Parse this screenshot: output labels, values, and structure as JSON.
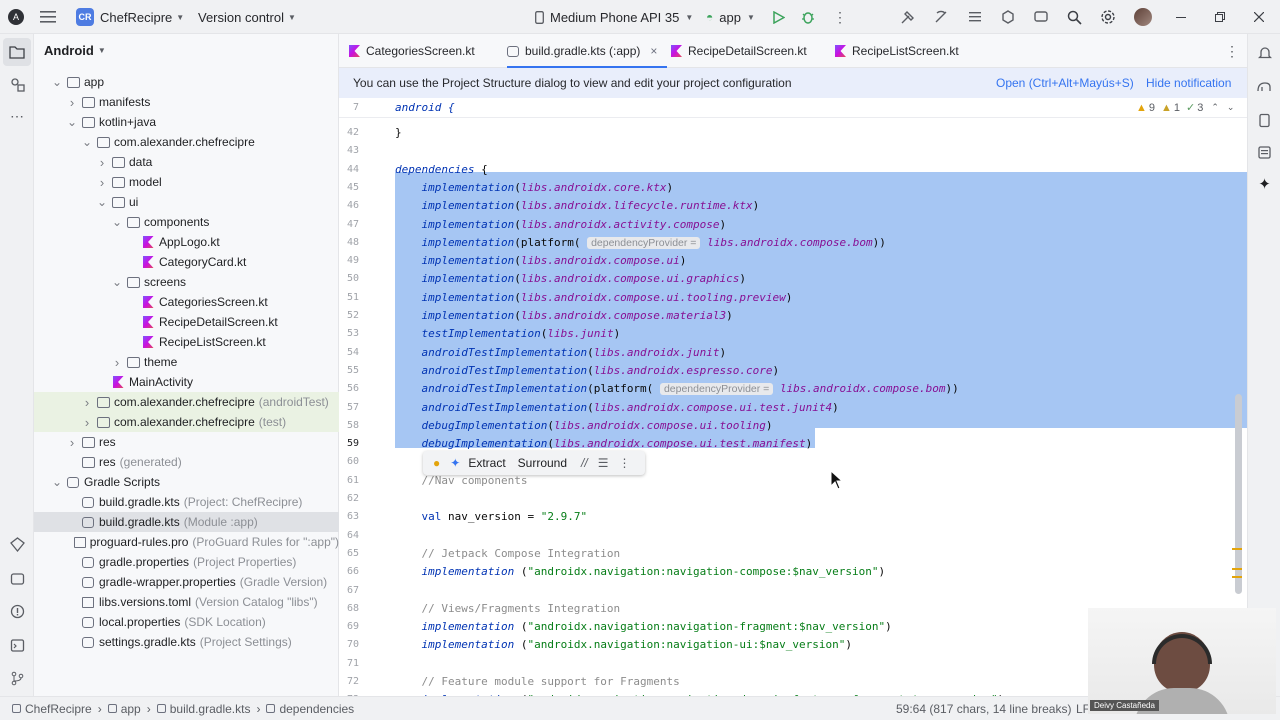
{
  "titlebar": {
    "project_badge": "CR",
    "project_name": "ChefRecipre",
    "vcs_label": "Version control",
    "device_label": "Medium Phone API 35",
    "run_config": "app"
  },
  "project_panel": {
    "view_label": "Android",
    "tree": [
      {
        "label": "app",
        "hint": "",
        "depth": 0,
        "icon": "folder",
        "expanded": true
      },
      {
        "label": "manifests",
        "hint": "",
        "depth": 1,
        "icon": "folder",
        "expanded": false
      },
      {
        "label": "kotlin+java",
        "hint": "",
        "depth": 1,
        "icon": "folder",
        "expanded": true
      },
      {
        "label": "com.alexander.chefrecipre",
        "hint": "",
        "depth": 2,
        "icon": "folder",
        "expanded": true
      },
      {
        "label": "data",
        "hint": "",
        "depth": 3,
        "icon": "folder",
        "expanded": false
      },
      {
        "label": "model",
        "hint": "",
        "depth": 3,
        "icon": "folder",
        "expanded": false
      },
      {
        "label": "ui",
        "hint": "",
        "depth": 3,
        "icon": "folder",
        "expanded": true
      },
      {
        "label": "components",
        "hint": "",
        "depth": 4,
        "icon": "folder",
        "expanded": true
      },
      {
        "label": "AppLogo.kt",
        "hint": "",
        "depth": 5,
        "icon": "kotlin",
        "expanded": null
      },
      {
        "label": "CategoryCard.kt",
        "hint": "",
        "depth": 5,
        "icon": "kotlin",
        "expanded": null
      },
      {
        "label": "screens",
        "hint": "",
        "depth": 4,
        "icon": "folder",
        "expanded": true
      },
      {
        "label": "CategoriesScreen.kt",
        "hint": "",
        "depth": 5,
        "icon": "kotlin",
        "expanded": null
      },
      {
        "label": "RecipeDetailScreen.kt",
        "hint": "",
        "depth": 5,
        "icon": "kotlin",
        "expanded": null
      },
      {
        "label": "RecipeListScreen.kt",
        "hint": "",
        "depth": 5,
        "icon": "kotlin",
        "expanded": null
      },
      {
        "label": "theme",
        "hint": "",
        "depth": 4,
        "icon": "folder",
        "expanded": false
      },
      {
        "label": "MainActivity",
        "hint": "",
        "depth": 3,
        "icon": "kotlin",
        "expanded": null
      },
      {
        "label": "com.alexander.chefrecipre",
        "hint": "(androidTest)",
        "depth": 2,
        "icon": "folder",
        "expanded": false
      },
      {
        "label": "com.alexander.chefrecipre",
        "hint": "(test)",
        "depth": 2,
        "icon": "folder",
        "expanded": false
      },
      {
        "label": "res",
        "hint": "",
        "depth": 1,
        "icon": "folder",
        "expanded": false
      },
      {
        "label": "res",
        "hint": "(generated)",
        "depth": 1,
        "icon": "folder",
        "expanded": null
      },
      {
        "label": "Gradle Scripts",
        "hint": "",
        "depth": 0,
        "icon": "gradle",
        "expanded": true
      },
      {
        "label": "build.gradle.kts",
        "hint": "(Project: ChefRecipre)",
        "depth": 1,
        "icon": "gradle",
        "expanded": null
      },
      {
        "label": "build.gradle.kts",
        "hint": "(Module :app)",
        "depth": 1,
        "icon": "gradle",
        "expanded": null
      },
      {
        "label": "proguard-rules.pro",
        "hint": "(ProGuard Rules for \":app\")",
        "depth": 1,
        "icon": "file",
        "expanded": null
      },
      {
        "label": "gradle.properties",
        "hint": "(Project Properties)",
        "depth": 1,
        "icon": "gradle",
        "expanded": null
      },
      {
        "label": "gradle-wrapper.properties",
        "hint": "(Gradle Version)",
        "depth": 1,
        "icon": "gradle",
        "expanded": null
      },
      {
        "label": "libs.versions.toml",
        "hint": "(Version Catalog \"libs\")",
        "depth": 1,
        "icon": "file",
        "expanded": null
      },
      {
        "label": "local.properties",
        "hint": "(SDK Location)",
        "depth": 1,
        "icon": "gradle",
        "expanded": null
      },
      {
        "label": "settings.gradle.kts",
        "hint": "(Project Settings)",
        "depth": 1,
        "icon": "gradle",
        "expanded": null
      }
    ]
  },
  "tabs": [
    {
      "label": "CategoriesScreen.kt",
      "active": false
    },
    {
      "label": "build.gradle.kts (:app)",
      "active": true
    },
    {
      "label": "RecipeDetailScreen.kt",
      "active": false
    },
    {
      "label": "RecipeListScreen.kt",
      "active": false
    }
  ],
  "notification": {
    "text": "You can use the Project Structure dialog to view and edit your project configuration",
    "open_link": "Open (Ctrl+Alt+Mayús+S)",
    "hide_link": "Hide notification"
  },
  "inspections": {
    "warnings": "9",
    "weak_warnings": "1",
    "typos": "3"
  },
  "editor": {
    "sticky_line_number": "7",
    "sticky_text": "android {",
    "lines": [
      {
        "n": "42",
        "t": "}"
      },
      {
        "n": "43",
        "t": ""
      },
      {
        "n": "44",
        "t": "dependencies {"
      },
      {
        "n": "45",
        "t": "    implementation(libs.androidx.core.ktx)"
      },
      {
        "n": "46",
        "t": "    implementation(libs.androidx.lifecycle.runtime.ktx)"
      },
      {
        "n": "47",
        "t": "    implementation(libs.androidx.activity.compose)"
      },
      {
        "n": "48",
        "t": "    implementation(platform( dependencyProvider = libs.androidx.compose.bom))"
      },
      {
        "n": "49",
        "t": "    implementation(libs.androidx.compose.ui)"
      },
      {
        "n": "50",
        "t": "    implementation(libs.androidx.compose.ui.graphics)"
      },
      {
        "n": "51",
        "t": "    implementation(libs.androidx.compose.ui.tooling.preview)"
      },
      {
        "n": "52",
        "t": "    implementation(libs.androidx.compose.material3)"
      },
      {
        "n": "53",
        "t": "    testImplementation(libs.junit)"
      },
      {
        "n": "54",
        "t": "    androidTestImplementation(libs.androidx.junit)"
      },
      {
        "n": "55",
        "t": "    androidTestImplementation(libs.androidx.espresso.core)"
      },
      {
        "n": "56",
        "t": "    androidTestImplementation(platform( dependencyProvider = libs.androidx.compose.bom))"
      },
      {
        "n": "57",
        "t": "    androidTestImplementation(libs.androidx.compose.ui.test.junit4)"
      },
      {
        "n": "58",
        "t": "    debugImplementation(libs.androidx.compose.ui.tooling)"
      },
      {
        "n": "59",
        "t": "    debugImplementation(libs.androidx.compose.ui.test.manifest)"
      },
      {
        "n": "60",
        "t": ""
      },
      {
        "n": "61",
        "t": "    //Nav components"
      },
      {
        "n": "62",
        "t": ""
      },
      {
        "n": "63",
        "t": "    val nav_version = \"2.9.7\""
      },
      {
        "n": "64",
        "t": ""
      },
      {
        "n": "65",
        "t": "    // Jetpack Compose Integration"
      },
      {
        "n": "66",
        "t": "    implementation (\"androidx.navigation:navigation-compose:$nav_version\")"
      },
      {
        "n": "67",
        "t": ""
      },
      {
        "n": "68",
        "t": "    // Views/Fragments Integration"
      },
      {
        "n": "69",
        "t": "    implementation (\"androidx.navigation:navigation-fragment:$nav_version\")"
      },
      {
        "n": "70",
        "t": "    implementation (\"androidx.navigation:navigation-ui:$nav_version\")"
      },
      {
        "n": "71",
        "t": ""
      },
      {
        "n": "72",
        "t": "    // Feature module support for Fragments"
      },
      {
        "n": "73",
        "t": "    implementation (\"androidx.navigation:navigation-dynamic-features-fragment:$nav_version\")"
      }
    ],
    "inlay_param": "dependencyProvider ="
  },
  "context_popup": {
    "extract": "Extract",
    "surround": "Surround"
  },
  "statusbar": {
    "breadcrumbs": [
      "ChefRecipre",
      "app",
      "build.gradle.kts",
      "dependencies"
    ],
    "position": "59:64 (817 chars, 14 line breaks)",
    "line_sep": "LF"
  },
  "webcam": {
    "name": "Deivy Castañeda"
  },
  "colors": {
    "accent": "#3574f0",
    "selection": "#a6c6f3",
    "notification_bg": "#e9eefb"
  }
}
